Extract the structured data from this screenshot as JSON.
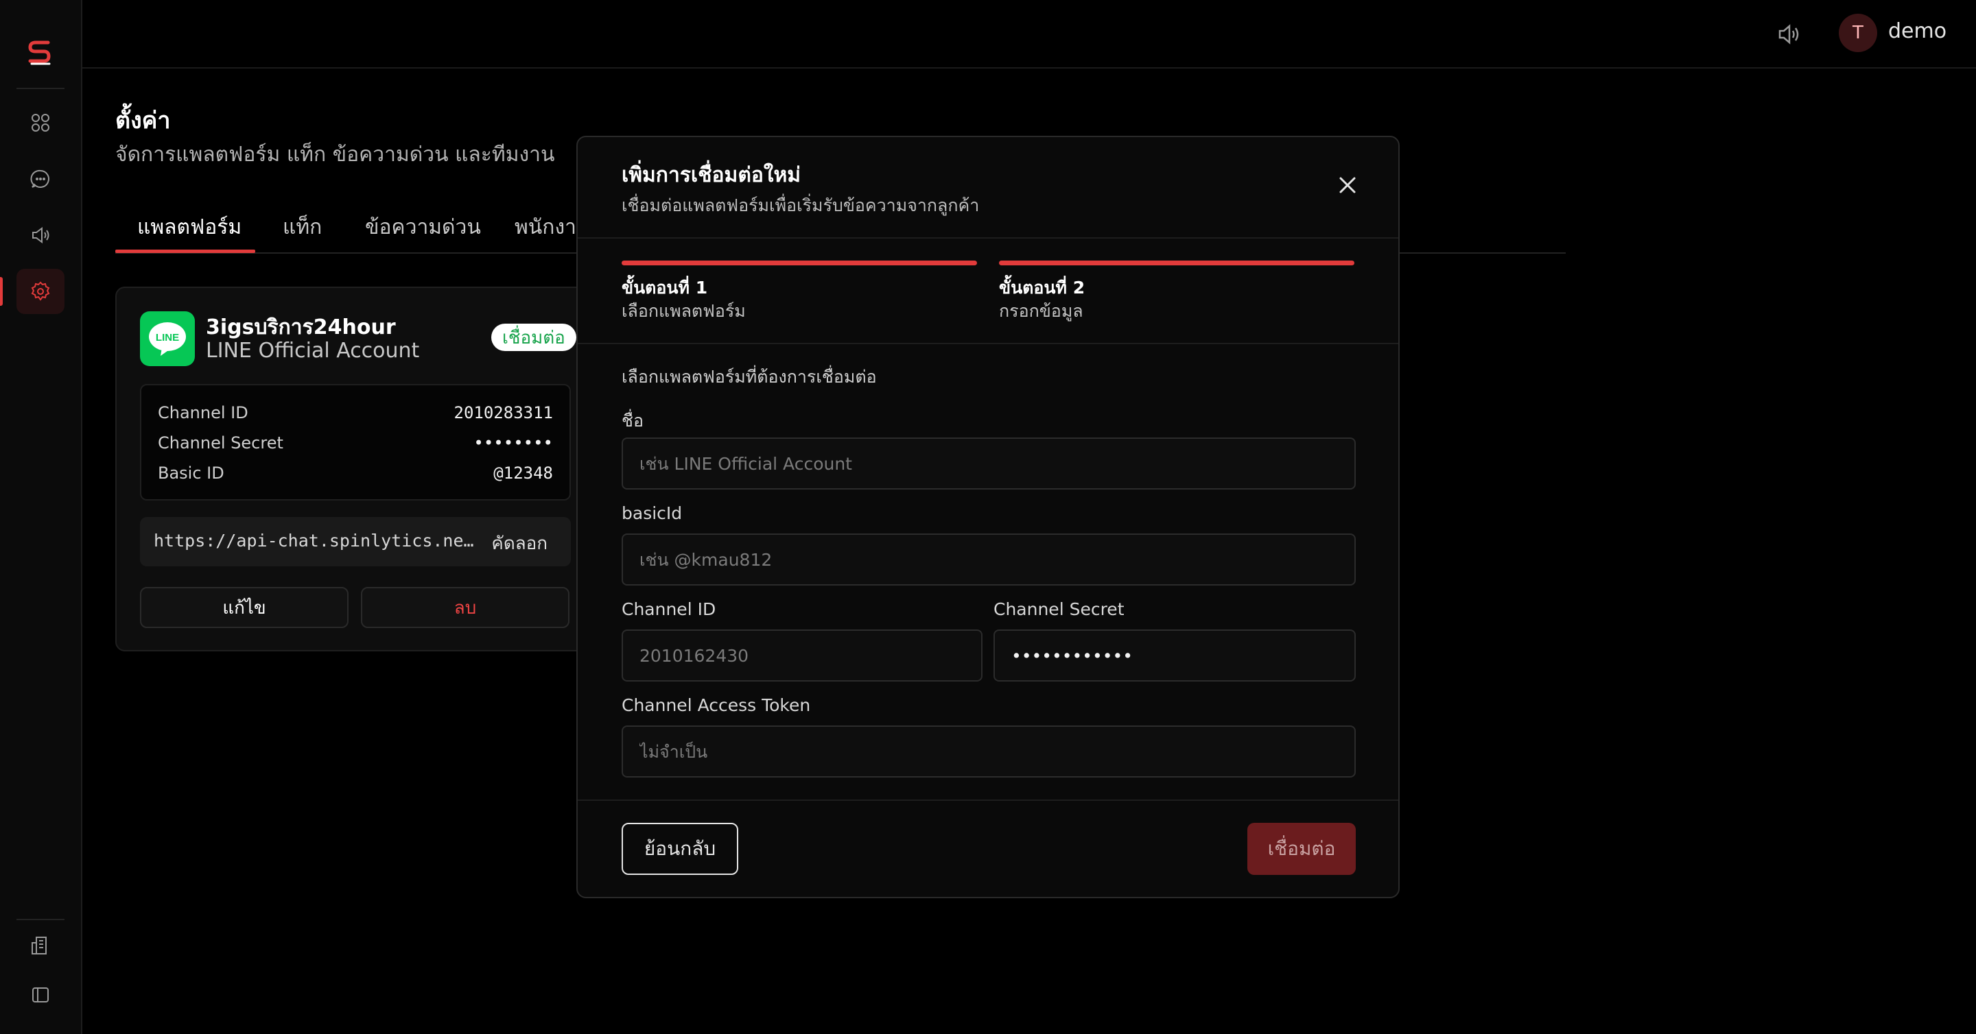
{
  "app": {
    "user_initial": "T",
    "username": "demo"
  },
  "sidebar": {
    "items": [
      {
        "name": "dashboard",
        "icon": "grid-icon"
      },
      {
        "name": "chat",
        "icon": "chat-bubble-icon"
      },
      {
        "name": "broadcast",
        "icon": "megaphone-icon"
      },
      {
        "name": "settings",
        "icon": "gear-icon",
        "active": true
      }
    ],
    "bottom_items": [
      {
        "name": "organization",
        "icon": "building-icon"
      },
      {
        "name": "collapse",
        "icon": "sidebar-toggle-icon"
      }
    ]
  },
  "page": {
    "title": "ตั้งค่า",
    "subtitle": "จัดการแพลตฟอร์ม แท็ก ข้อความด่วน และทีมงาน",
    "tabs": [
      {
        "label": "แพลตฟอร์ม",
        "active": true
      },
      {
        "label": "แท็ก"
      },
      {
        "label": "ข้อความด่วน"
      },
      {
        "label": "พนักงาน"
      }
    ]
  },
  "platform_card": {
    "name": "3igsบริการ24hour",
    "type": "LINE Official Account",
    "logo_text": "LINE",
    "status": "เชื่อมต่อ",
    "credentials": [
      {
        "label": "Channel ID",
        "value": "2010283311"
      },
      {
        "label": "Channel Secret",
        "value": "••••••••"
      },
      {
        "label": "Basic ID",
        "value": "@12348"
      }
    ],
    "webhook_url": "https://api-chat.spinlytics.net/webhook/line",
    "copy_label": "คัดลอก",
    "edit_label": "แก้ไข",
    "delete_label": "ลบ"
  },
  "modal": {
    "title": "เพิ่มการเชื่อมต่อใหม่",
    "subtitle": "เชื่อมต่อแพลตฟอร์มเพื่อเริ่มรับข้อความจากลูกค้า",
    "steps": [
      {
        "title": "ขั้นตอนที่ 1",
        "desc": "เลือกแพลตฟอร์ม"
      },
      {
        "title": "ขั้นตอนที่ 2",
        "desc": "กรอกข้อมูล"
      }
    ],
    "section_label": "เลือกแพลตฟอร์มที่ต้องการเชื่อมต่อ",
    "fields": {
      "name": {
        "label": "ชื่อ",
        "placeholder": "เช่น LINE Official Account"
      },
      "basic_id": {
        "label": "basicId",
        "placeholder": "เช่น @kmau812"
      },
      "channel_id": {
        "label": "Channel ID",
        "placeholder": "2010162430"
      },
      "channel_secret": {
        "label": "Channel Secret",
        "value": "••••••••••••"
      },
      "access_token": {
        "label": "Channel Access Token",
        "placeholder": "ไม่จำเป็น"
      }
    },
    "back_label": "ย้อนกลับ",
    "connect_label": "เชื่อมต่อ"
  },
  "colors": {
    "accent": "#e23b3b",
    "line_green": "#06c755",
    "background": "#000000"
  }
}
